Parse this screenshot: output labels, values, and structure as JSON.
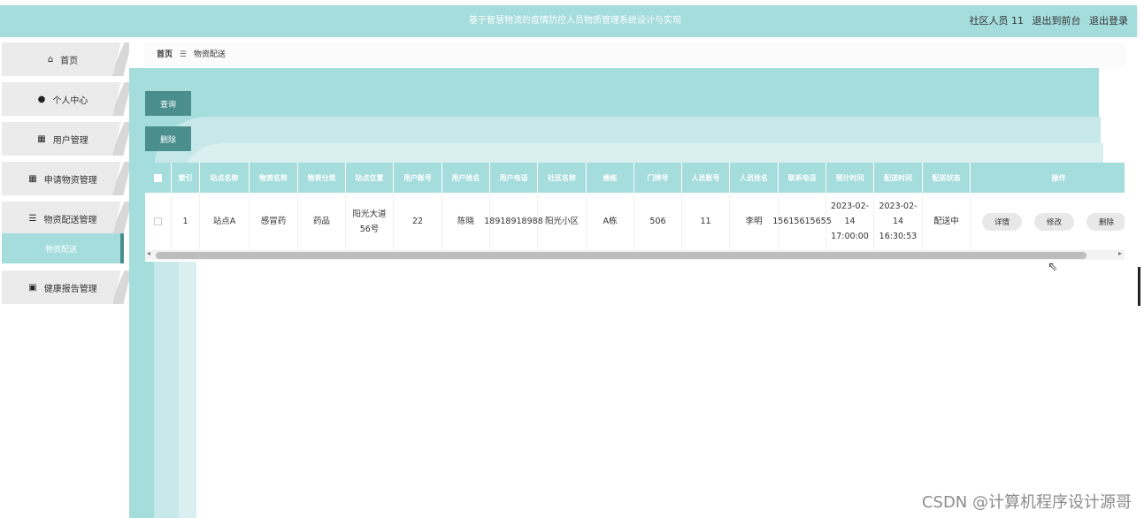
{
  "header": {
    "title": "基于智慧物流的疫情防控人员物质管理系统设计与实现",
    "user": "社区人员 11",
    "back_front": "退出到前台",
    "logout": "退出登录"
  },
  "sidebar": {
    "items": [
      {
        "label": "首页",
        "icon": "home-icon",
        "glyph": "⌂"
      },
      {
        "label": "个人中心",
        "icon": "user-icon",
        "glyph": "●"
      },
      {
        "label": "用户管理",
        "icon": "grid-icon",
        "glyph": "▦"
      },
      {
        "label": "申请物资管理",
        "icon": "grid-icon",
        "glyph": "▦"
      },
      {
        "label": "物资配送管理",
        "icon": "sliders-icon",
        "glyph": "☰"
      },
      {
        "label": "健康报告管理",
        "icon": "report-icon",
        "glyph": "▣"
      }
    ],
    "active_sub": "物资配送"
  },
  "breadcrumb": {
    "home": "首页",
    "sep": "☰",
    "current": "物资配送"
  },
  "buttons": {
    "query": "查询",
    "delete": "删除"
  },
  "table": {
    "headers": [
      "索引",
      "站点名称",
      "物资名称",
      "物资分类",
      "站点位置",
      "用户账号",
      "用户姓名",
      "用户电话",
      "社区名称",
      "楼栋",
      "门牌号",
      "人员账号",
      "人员姓名",
      "联系电话",
      "预计时间",
      "配送时间",
      "配送状态",
      "操作"
    ],
    "rows": [
      {
        "cells": [
          "1",
          "站点A",
          "感冒药",
          "药品",
          "阳光大道56号",
          "22",
          "陈晓",
          "18918918988",
          "阳光小区",
          "A栋",
          "506",
          "11",
          "李明",
          "15615615655",
          "2023-02-14 17:00:00",
          "2023-02-14 16:30:53",
          "配送中"
        ],
        "actions": [
          "详情",
          "修改",
          "删除"
        ]
      }
    ]
  },
  "watermark": "CSDN @计算机程序设计源哥",
  "colors": {
    "accent": "#a5dcdc",
    "button_dark": "#4a8e8e"
  }
}
